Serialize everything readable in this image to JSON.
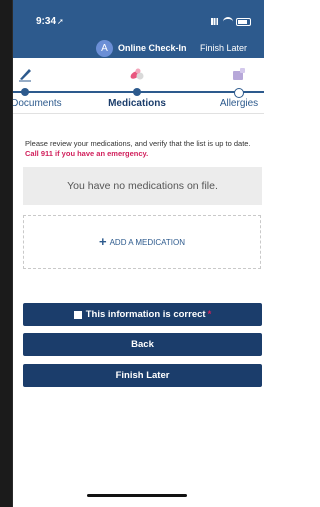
{
  "status_bar": {
    "time": "9:34"
  },
  "header": {
    "avatar_letter": "A",
    "title": "Online Check-In",
    "finish_later": "Finish Later"
  },
  "steps": [
    {
      "label": "Sign Documents",
      "icon": "pen-icon"
    },
    {
      "label": "Medications",
      "icon": "pills-icon"
    },
    {
      "label": "Allergies",
      "icon": "allergy-icon"
    }
  ],
  "intro": {
    "text": "Please review your medications, and verify that the list is up to date.",
    "emergency": "Call 911 if you have an emergency."
  },
  "medications": {
    "empty_message": "You have no medications on file."
  },
  "add": {
    "label": "ADD A MEDICATION"
  },
  "buttons": {
    "correct": "This information is correct",
    "required_mark": "*",
    "back": "Back",
    "finish_later": "Finish Later"
  },
  "colors": {
    "brand": "#2d5a8d",
    "dark": "#1b3d6b",
    "emergency": "#d11f5b"
  }
}
